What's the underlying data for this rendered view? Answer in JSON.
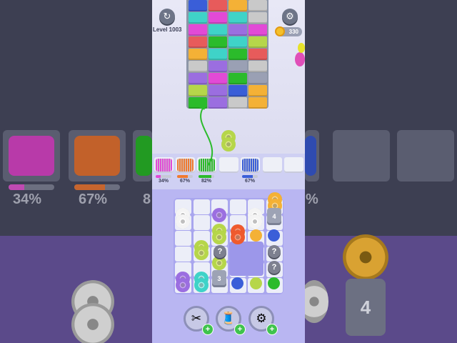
{
  "hud": {
    "level_label": "Level 1003",
    "coins": "330",
    "undo_icon": "undo-icon",
    "settings_icon": "gear-icon"
  },
  "reels": [
    {
      "color": "#e24ad6",
      "percent": "34%",
      "fill": 0.34
    },
    {
      "color": "#f07a2f",
      "percent": "67%",
      "fill": 0.67
    },
    {
      "color": "#2bbb2b",
      "percent": "82%",
      "fill": 0.82
    },
    {
      "color": "#3a5ed8",
      "percent": "67%",
      "fill": 0.67
    }
  ],
  "board": {
    "bin_counts": [
      "4",
      "3"
    ],
    "question_mark": "?"
  },
  "bg": {
    "pcts": [
      "34%",
      "67%",
      "8",
      "%",
      "4"
    ]
  },
  "powerups": [
    {
      "name": "scissors",
      "icon": "✂"
    },
    {
      "name": "thread",
      "icon": "🧵"
    },
    {
      "name": "magnet",
      "icon": "⚙"
    }
  ],
  "powerup_plus": "+",
  "colors": {
    "pink": "#e24ad6",
    "orange": "#f07a2f",
    "green": "#2bbb2b",
    "blue": "#3a5ed8",
    "lime": "#b6d64a",
    "white": "#f4f4f4",
    "purple": "#9b6ee0",
    "teal": "#3fd3c8",
    "yellow": "#f4b136"
  }
}
